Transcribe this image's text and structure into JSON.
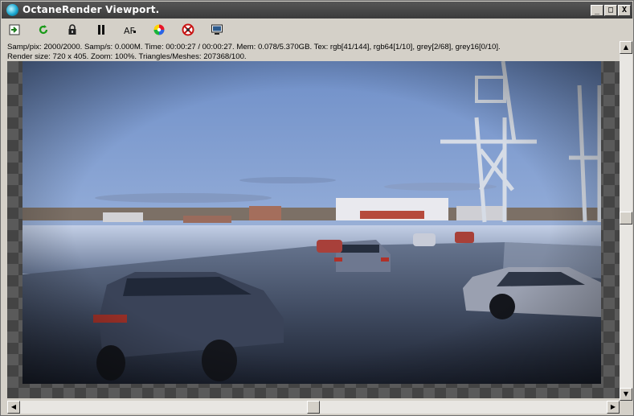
{
  "window": {
    "title": "OctaneRender Viewport.",
    "minimize": "_",
    "maximize": "□",
    "close": "X"
  },
  "toolbar": {
    "items": [
      "import-icon",
      "refresh-icon",
      "lock-icon",
      "pause-icon",
      "autofocus-icon",
      "color-picker-icon",
      "region-render-icon",
      "display-icon"
    ],
    "af_label": "AF"
  },
  "status": {
    "line1": "Samp/pix: 2000/2000.   Samp/s: 0.000M.   Time: 00:00:27 / 00:00:27.   Mem: 0.078/5.370GB.   Tex: rgb[41/144], rgb64[1/10], grey[2/68], grey16[0/10].",
    "line2": "Render size: 720 x 405.   Zoom: 100%.   Triangles/Meshes: 207368/100."
  },
  "scrollbars": {
    "up": "▲",
    "down": "▼",
    "left": "◀",
    "right": "▶"
  },
  "colors": {
    "titlebar": "#3b3b3b",
    "chrome": "#d4d0c8",
    "checker_dark": "#444444",
    "checker_light": "#5a5a5a"
  }
}
